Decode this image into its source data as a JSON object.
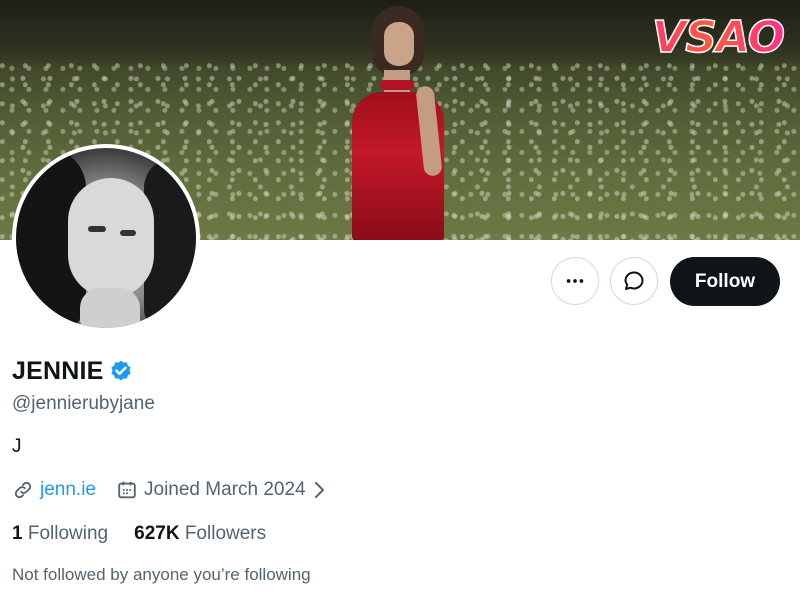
{
  "profile": {
    "display_name": "JENNIE",
    "handle": "@jennierubyjane",
    "bio": "J",
    "website": "jenn.ie",
    "joined": "Joined March 2024",
    "following_count": "1",
    "following_label": "Following",
    "followers_count": "627K",
    "followers_label": "Followers",
    "not_followed_text": "Not followed by anyone you’re following"
  },
  "actions": {
    "follow_label": "Follow"
  },
  "watermark": {
    "text": "VSAO"
  },
  "colors": {
    "accent": "#1d9bf0",
    "follow_bg": "#0f1419",
    "secondary_text": "#536471"
  },
  "icons": {
    "more": "more-horizontal-icon",
    "message": "message-bubble-icon",
    "verified": "verified-badge-icon",
    "link": "link-icon",
    "calendar": "calendar-icon",
    "chevron": "chevron-right-icon"
  }
}
